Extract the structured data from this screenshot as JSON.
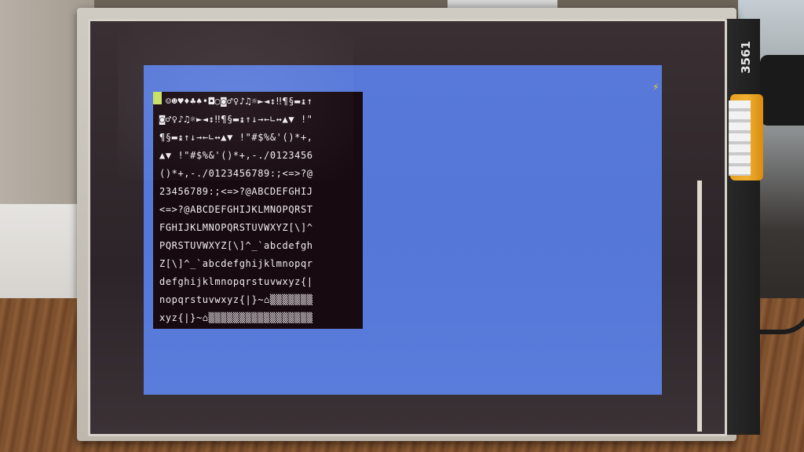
{
  "board": {
    "label": "3561"
  },
  "screen": {
    "background_color": "#5a7bda",
    "terminal_background": "#170a10",
    "cursor_color": "#c8e060",
    "activity_icon": "lightning-icon",
    "activity_glyph": "⚡"
  },
  "terminal": {
    "lines": [
      " ☺☻♥♦♣♠•◘○◙♂♀♪♫☼►◄↕‼¶§▬↨↑",
      "◙♂♀♪♫☼►◄↕‼¶§▬↨↑↓→←∟↔▲▼ !\"",
      "¶§▬↨↑↓→←∟↔▲▼ !\"#$%&'()*+,",
      "▲▼ !\"#$%&'()*+,-./0123456",
      "()*+,-./0123456789:;<=>?@",
      "23456789:;<=>?@ABCDEFGHIJ",
      "<=>?@ABCDEFGHIJKLMNOPQRST",
      "FGHIJKLMNOPQRSTUVWXYZ[\\]^",
      "PQRSTUVWXYZ[\\]^_`abcdefgh",
      "Z[\\]^_`abcdefghijklmnopqr",
      "defghijklmnopqrstuvwxyz{|",
      "nopqrstuvwxyz{|}~⌂▒▒▒▒▒▒▒",
      "xyz{|}~⌂▒▒▒▒▒▒▒▒▒▒▒▒▒▒▒▒▒"
    ]
  }
}
